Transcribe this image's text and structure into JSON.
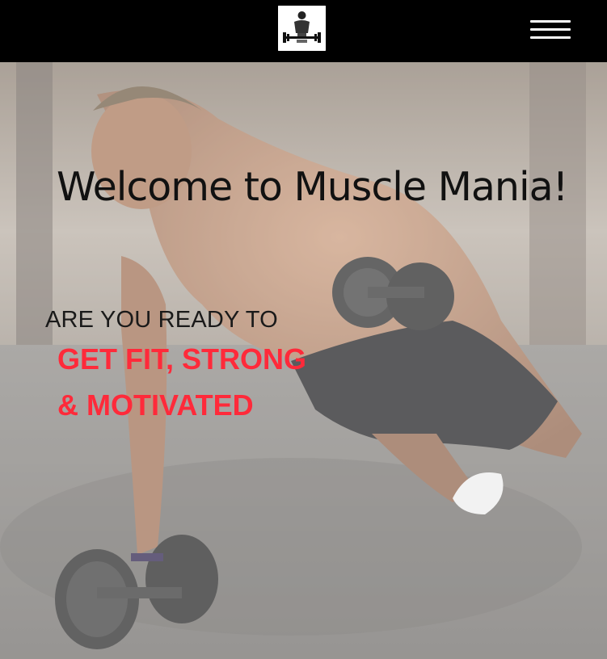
{
  "header": {
    "logo_icon": "gym-weightlifter-logo-icon",
    "menu_icon": "hamburger-menu-icon"
  },
  "hero": {
    "title": "Welcome to Muscle Mania!",
    "subtitle": "ARE YOU READY TO",
    "highlight_line_1": "GET FIT, STRONG",
    "highlight_line_2": "& MOTIVATED",
    "highlight_color": "#ff2a3a"
  }
}
